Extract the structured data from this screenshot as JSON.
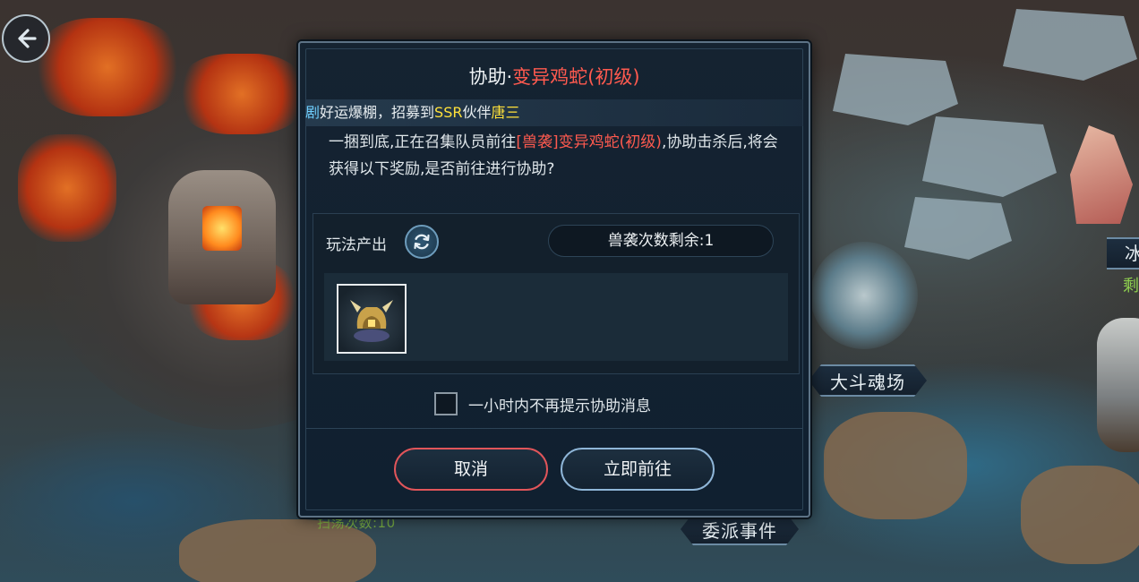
{
  "map": {
    "labels": {
      "arena": "大斗魂场",
      "dispatch": "委派事件",
      "partial_right": "冰",
      "partial_right_green": "剩",
      "sweep": "扫荡次数:10"
    }
  },
  "back_button": {
    "icon": "back-arrow-icon"
  },
  "dialog": {
    "title_prefix": "协助·",
    "title_monster": "变异鸡蛇(初级)",
    "ticker": {
      "cut": "剧",
      "text1": "好运爆棚，招募到",
      "highlight1": "SSR",
      "text2": "伙伴",
      "highlight2": "唐三"
    },
    "message": {
      "part1": "一捆到底,正在召集队员前往",
      "highlight": "[兽袭]变异鸡蛇(初级)",
      "part2": ",协助击杀后,将会获得以下奖励,是否前往进行协助?"
    },
    "reward": {
      "label": "玩法产出",
      "refresh_icon": "refresh-icon",
      "remaining": "兽袭次数剩余:1",
      "items": [
        {
          "icon": "golden-helmet-icon"
        }
      ]
    },
    "checkbox": {
      "label": "一小时内不再提示协助消息",
      "checked": false
    },
    "buttons": {
      "cancel": "取消",
      "go": "立即前往"
    }
  },
  "colors": {
    "highlight_red": "#ff5a4f",
    "highlight_yellow": "#ffe13a",
    "cancel_border": "#e1555a",
    "go_border": "#8fb6d8"
  }
}
